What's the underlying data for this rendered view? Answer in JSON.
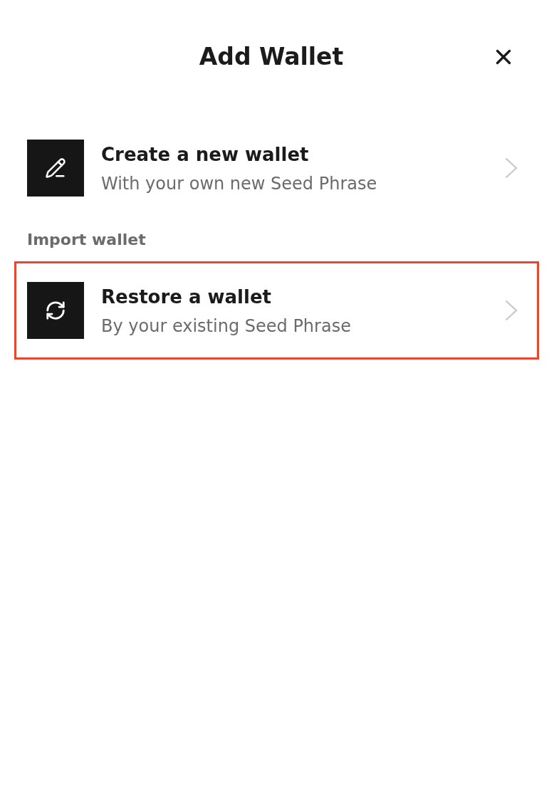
{
  "header": {
    "title": "Add Wallet"
  },
  "sections": [
    {
      "options": [
        {
          "kind": "create",
          "title": "Create a new wallet",
          "subtitle": "With your own new Seed Phrase",
          "highlighted": false
        }
      ]
    },
    {
      "label": "Import wallet",
      "options": [
        {
          "kind": "restore",
          "title": "Restore a wallet",
          "subtitle": "By your existing Seed Phrase",
          "highlighted": true
        }
      ]
    }
  ]
}
